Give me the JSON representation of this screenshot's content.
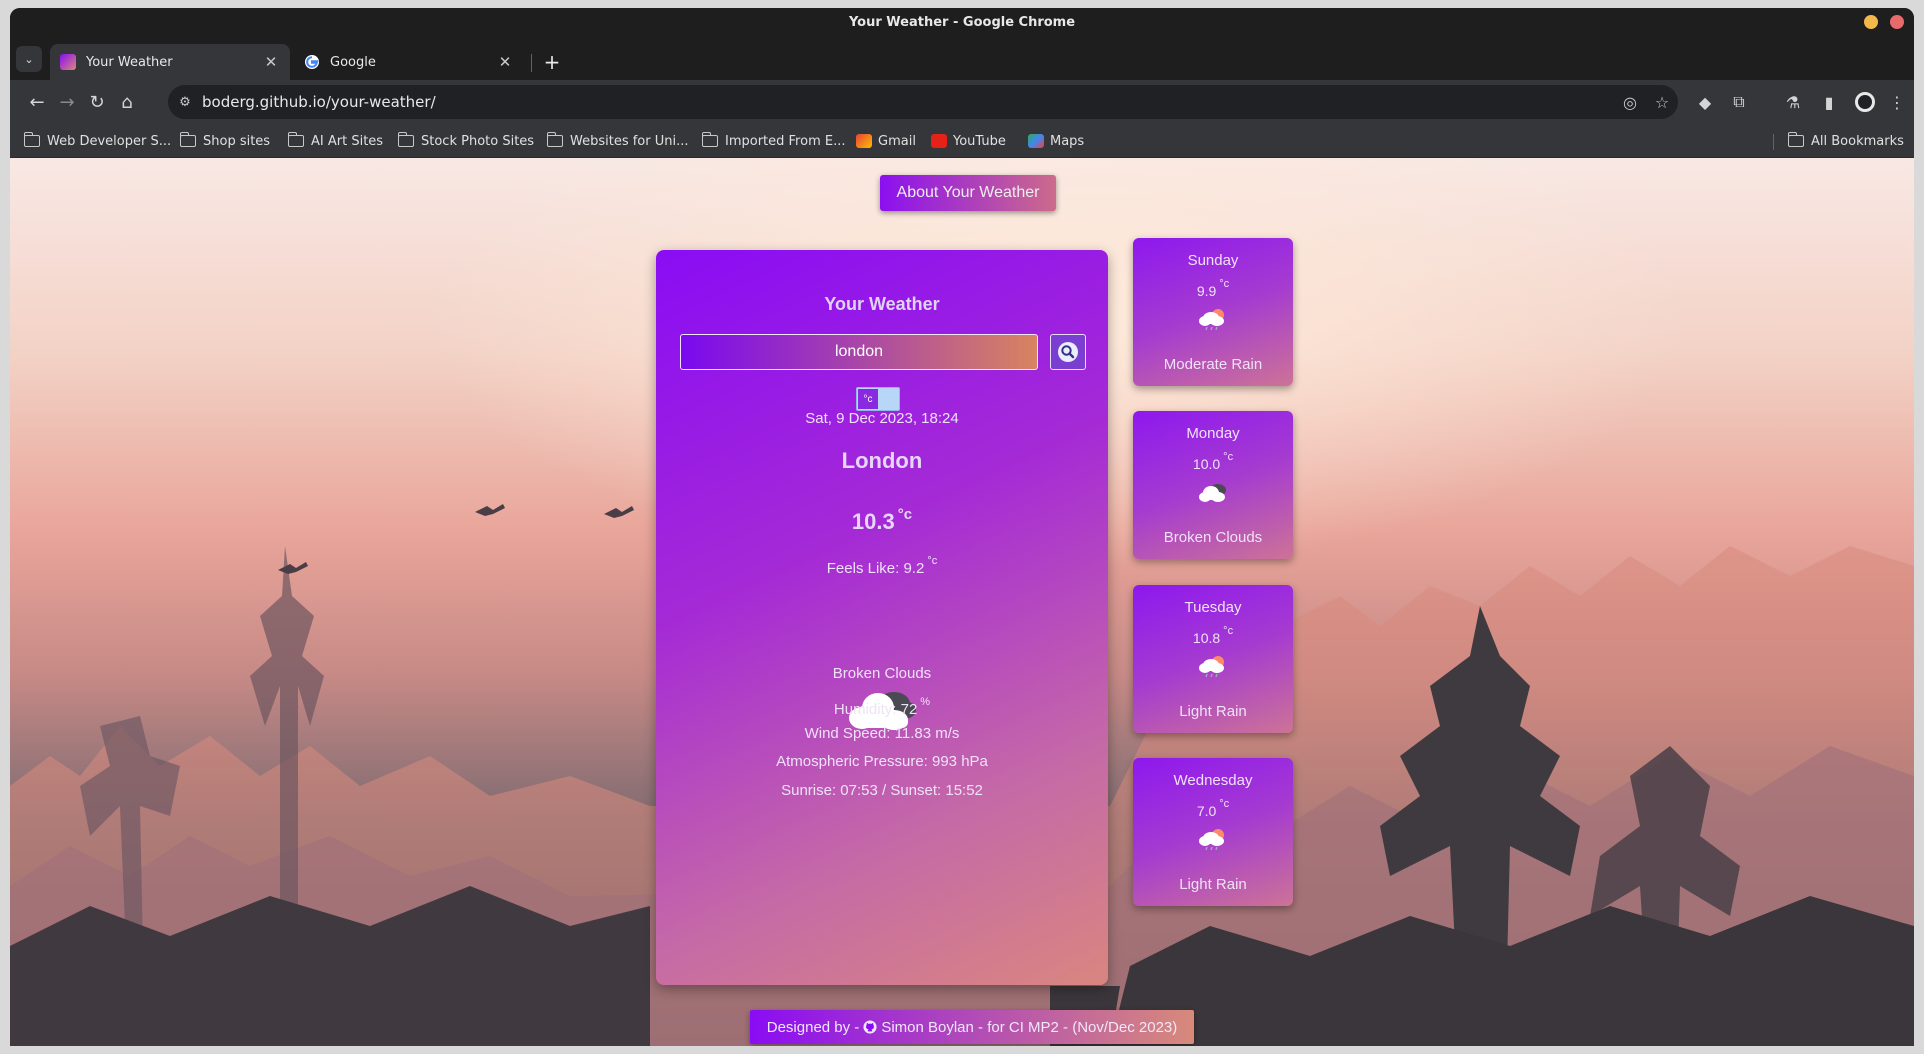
{
  "window": {
    "title": "Your Weather - Google Chrome"
  },
  "tabs": [
    {
      "title": "Your Weather",
      "active": true
    },
    {
      "title": "Google",
      "active": false
    }
  ],
  "address_bar": {
    "url": "boderg.github.io/your-weather/"
  },
  "bookmarks": [
    {
      "label": "Web Developer S...",
      "icon": "folder-icon"
    },
    {
      "label": "Shop sites",
      "icon": "folder-icon"
    },
    {
      "label": "AI Art Sites",
      "icon": "folder-icon"
    },
    {
      "label": "Stock Photo Sites",
      "icon": "folder-icon"
    },
    {
      "label": "Websites for Uni...",
      "icon": "folder-icon"
    },
    {
      "label": "Imported From E...",
      "icon": "folder-icon"
    },
    {
      "label": "Gmail",
      "icon": "gmail-icon"
    },
    {
      "label": "YouTube",
      "icon": "youtube-icon"
    },
    {
      "label": "Maps",
      "icon": "maps-icon"
    }
  ],
  "all_bookmarks_label": "All Bookmarks",
  "page": {
    "about_button": "About Your Weather",
    "card_title": "Your Weather",
    "search": {
      "value": "london",
      "placeholder": ""
    },
    "unit_toggle": {
      "label": "°c"
    },
    "date_time": "Sat, 9 Dec 2023, 18:24",
    "city": "London",
    "temperature": {
      "value": "10.3",
      "unit": "°c"
    },
    "feels_like": {
      "label": "Feels Like: 9.2",
      "unit": "°c"
    },
    "icon": "broken-clouds-icon",
    "description": "Broken Clouds",
    "humidity": {
      "label": "Humidity: 72",
      "unit": "%"
    },
    "wind_speed": "Wind Speed: 11.83 m/s",
    "pressure": "Atmospheric Pressure: 993 hPa",
    "sun": "Sunrise: 07:53 / Sunset: 15:52"
  },
  "forecast": [
    {
      "day": "Sunday",
      "temp": "9.9",
      "unit": "°c",
      "description": "Moderate Rain",
      "icon": "rain-cloud-icon"
    },
    {
      "day": "Monday",
      "temp": "10.0",
      "unit": "°c",
      "description": "Broken Clouds",
      "icon": "broken-clouds-icon"
    },
    {
      "day": "Tuesday",
      "temp": "10.8",
      "unit": "°c",
      "description": "Light Rain",
      "icon": "rain-cloud-icon"
    },
    {
      "day": "Wednesday",
      "temp": "7.0",
      "unit": "°c",
      "description": "Light Rain",
      "icon": "rain-cloud-icon"
    }
  ],
  "footer": {
    "prefix": "Designed by -",
    "suffix": "Simon Boylan - for CI MP2 - (Nov/Dec 2023)"
  },
  "colors": {
    "accent_purple": "#8a0cf4",
    "accent_peach": "#d88a7a",
    "chrome_dark": "#202124"
  }
}
